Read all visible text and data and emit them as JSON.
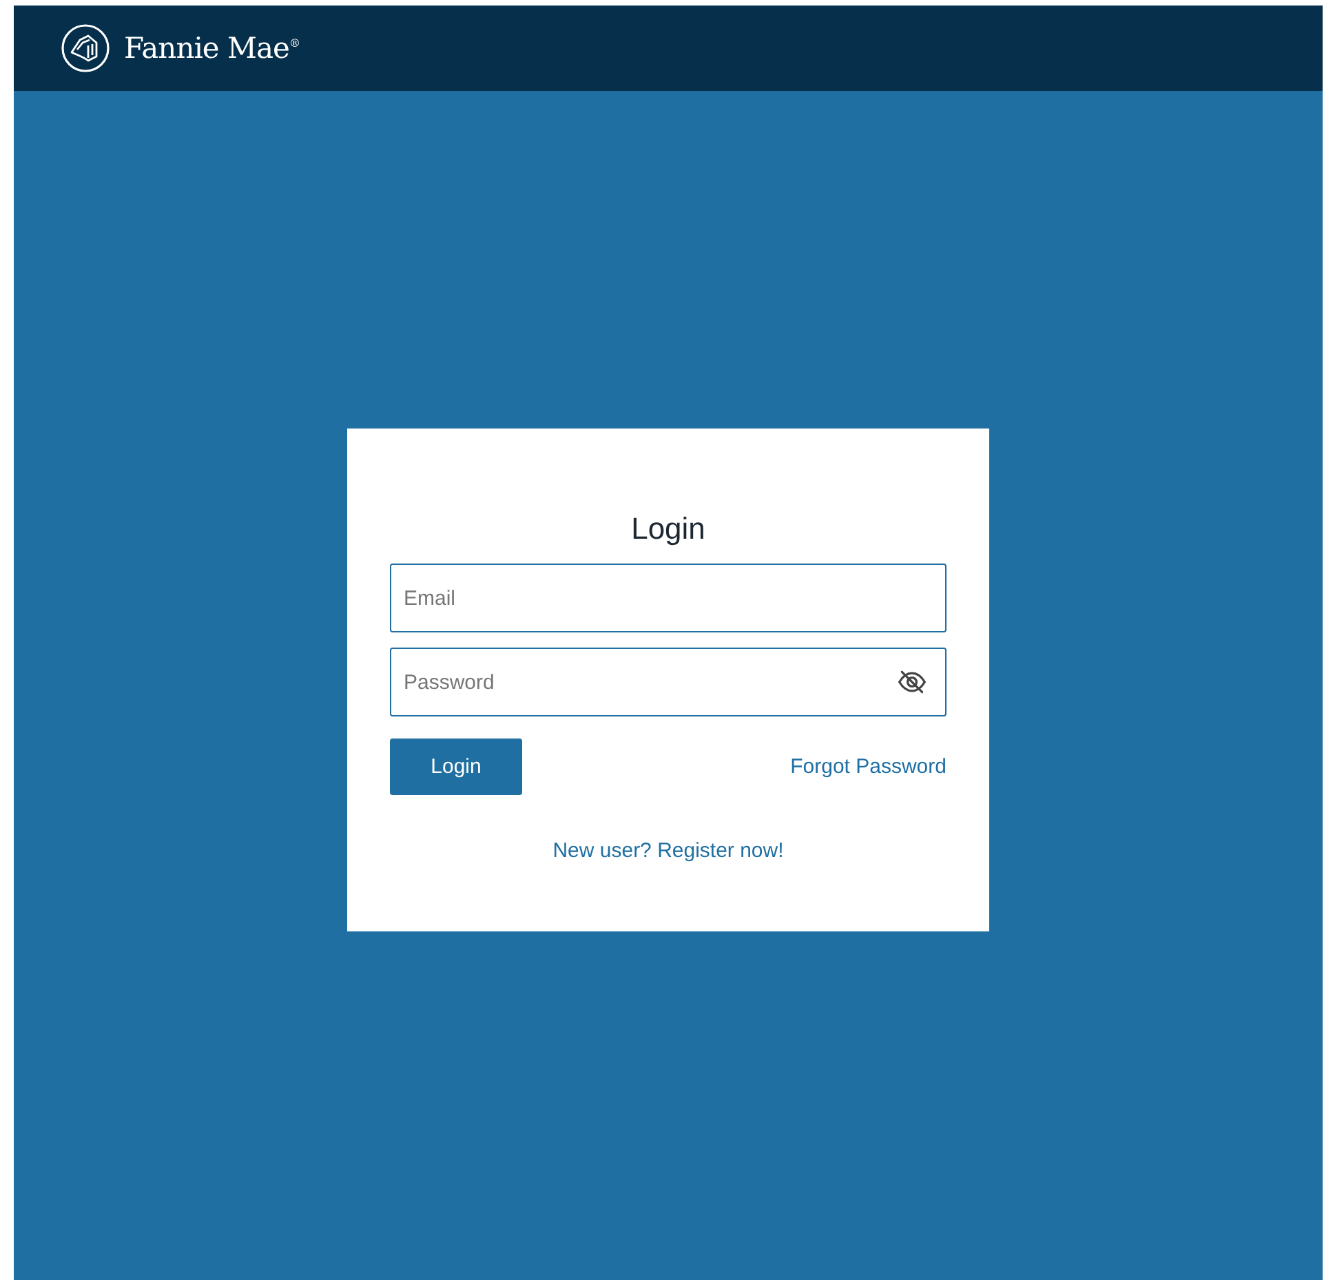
{
  "header": {
    "brand": "Fannie Mae$^{®}$"
  },
  "login": {
    "title": "Login",
    "fields": [
      {
        "kind": "email",
        "placeholder": "Email"
      },
      {
        "kind": "password",
        "placeholder": "Password"
      }
    ],
    "button": "Login",
    "forgot_link": "Forgot Password",
    "register_link": "New user? Register now!"
  }
}
